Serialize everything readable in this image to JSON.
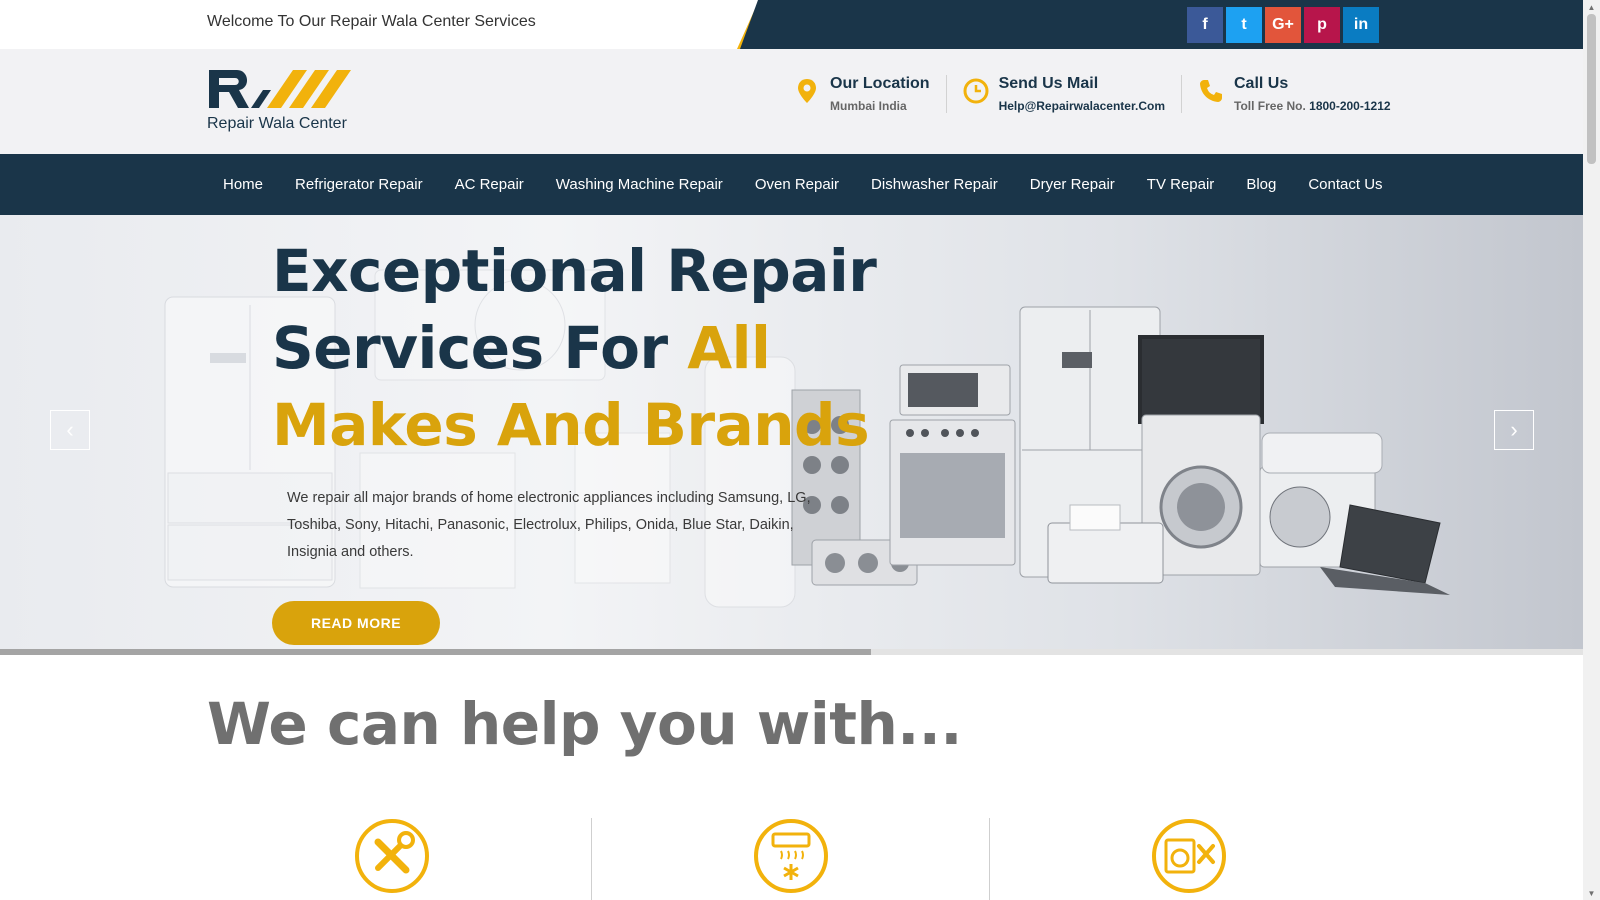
{
  "topbar": {
    "welcome": "Welcome To Our Repair Wala Center Services",
    "social": [
      {
        "name": "facebook-icon",
        "glyph": "f",
        "color": "#3b5998"
      },
      {
        "name": "twitter-icon",
        "glyph": "t",
        "color": "#1da1f2"
      },
      {
        "name": "google-plus-icon",
        "glyph": "G+",
        "color": "#e2553b"
      },
      {
        "name": "pinterest-icon",
        "glyph": "p",
        "color": "#b7154b"
      },
      {
        "name": "linkedin-icon",
        "glyph": "in",
        "color": "#0a7cc2"
      }
    ]
  },
  "header": {
    "logo_text": "Repair Wala Center",
    "location": {
      "title": "Our Location",
      "value": "Mumbai India"
    },
    "mail": {
      "title": "Send Us Mail",
      "value": "Help@Repairwalacenter.Com"
    },
    "call": {
      "title": "Call Us",
      "label": "Toll Free No.",
      "value": "1800-200-1212"
    }
  },
  "nav": [
    "Home",
    "Refrigerator Repair",
    "AC Repair",
    "Washing Machine Repair",
    "Oven Repair",
    "Dishwasher Repair",
    "Dryer Repair",
    "TV Repair",
    "Blog",
    "Contact Us"
  ],
  "hero": {
    "title_line1": "Exceptional Repair",
    "title_line2_a": "Services For ",
    "title_line2_b": "All",
    "title_line3": "Makes And Brands",
    "description": "We repair all major brands of home electronic appliances including Samsung, LG, Toshiba, Sony, Hitachi, Panasonic, Electrolux, Philips, Onida, Blue Star, Daikin, Insignia and others.",
    "button": "READ MORE",
    "prev": "‹",
    "next": "›",
    "progress": 0.55
  },
  "section": {
    "title": "We can help you with..."
  },
  "colors": {
    "navy": "#1a3549",
    "gold": "#d9a30c",
    "yellow": "#f2b20c"
  }
}
